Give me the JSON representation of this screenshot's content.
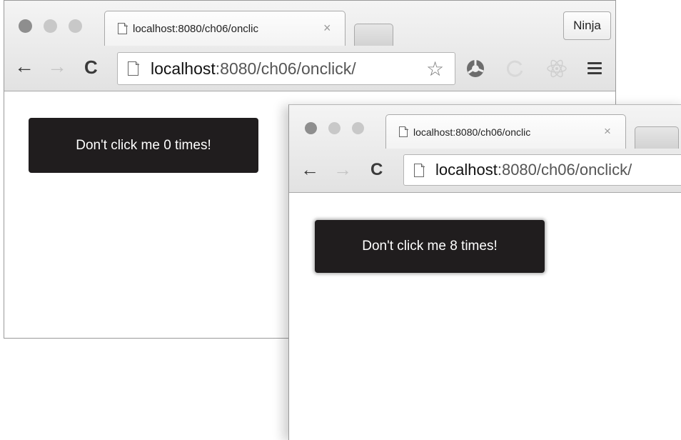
{
  "window_back": {
    "tab": {
      "title": "localhost:8080/ch06/onclic",
      "close": "×"
    },
    "profile_label": "Ninja",
    "nav": {
      "back": "←",
      "forward": "→",
      "reload": "C"
    },
    "address": {
      "host": "localhost",
      "path": ":8080/ch06/onclick/"
    },
    "bookmark_icon": "☆",
    "extensions": [
      "chrome-extension-icon",
      "refresh-extension-icon",
      "react-devtools-icon"
    ],
    "menu_icon": "hamburger-menu-icon",
    "button_label": "Don't click me 0 times!"
  },
  "window_front": {
    "tab": {
      "title": "localhost:8080/ch06/onclic",
      "close": "×"
    },
    "nav": {
      "back": "←",
      "forward": "→",
      "reload": "C"
    },
    "address": {
      "host": "localhost",
      "path": ":8080/ch06/onclick/"
    },
    "button_label": "Don't click me 8 times!"
  }
}
